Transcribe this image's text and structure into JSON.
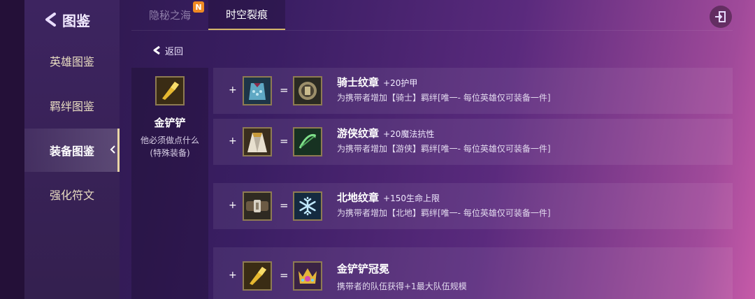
{
  "sidebar": {
    "title": "图鉴",
    "items": [
      {
        "label": "英雄图鉴",
        "active": false
      },
      {
        "label": "羁绊图鉴",
        "active": false
      },
      {
        "label": "装备图鉴",
        "active": true
      },
      {
        "label": "强化符文",
        "active": false
      }
    ]
  },
  "tabs": [
    {
      "label": "隐秘之海",
      "badge": "N",
      "active": false
    },
    {
      "label": "时空裂痕",
      "badge": "",
      "active": true
    }
  ],
  "back": {
    "label": "返回"
  },
  "item": {
    "name": "金铲铲",
    "desc_line1": "他必须做点什么",
    "desc_line2": "(特殊装备)",
    "icon": "golden-spatula-icon"
  },
  "recipes": [
    {
      "plus": "+",
      "eq": "=",
      "ingredient_icon": "chain-vest-icon",
      "result_icon": "knight-emblem-icon",
      "name": "骑士纹章",
      "bonus": "+20护甲",
      "desc": "为携带者增加【骑士】羁绊[唯一- 每位英雄仅可装备一件]"
    },
    {
      "plus": "+",
      "eq": "=",
      "ingredient_icon": "negatron-cloak-icon",
      "result_icon": "ranger-emblem-icon",
      "name": "游侠纹章",
      "bonus": "+20魔法抗性",
      "desc": "为携带者增加【游侠】羁绊[唯一- 每位英雄仅可装备一件]"
    },
    {
      "plus": "+",
      "eq": "=",
      "ingredient_icon": "giants-belt-icon",
      "result_icon": "glacial-emblem-icon",
      "name": "北地纹章",
      "bonus": "+150生命上限",
      "desc": "为携带者增加【北地】羁绊[唯一- 每位英雄仅可装备一件]"
    },
    {
      "plus": "+",
      "eq": "=",
      "ingredient_icon": "golden-spatula-icon",
      "result_icon": "force-of-nature-icon",
      "name": "金铲铲冠冕",
      "bonus": "",
      "desc": "携带者的队伍获得+1最大队伍规模"
    }
  ],
  "colors": {
    "accent_gold": "#d4b66a",
    "badge_orange": "#f08a23",
    "label_cream": "#e8dcc1"
  }
}
